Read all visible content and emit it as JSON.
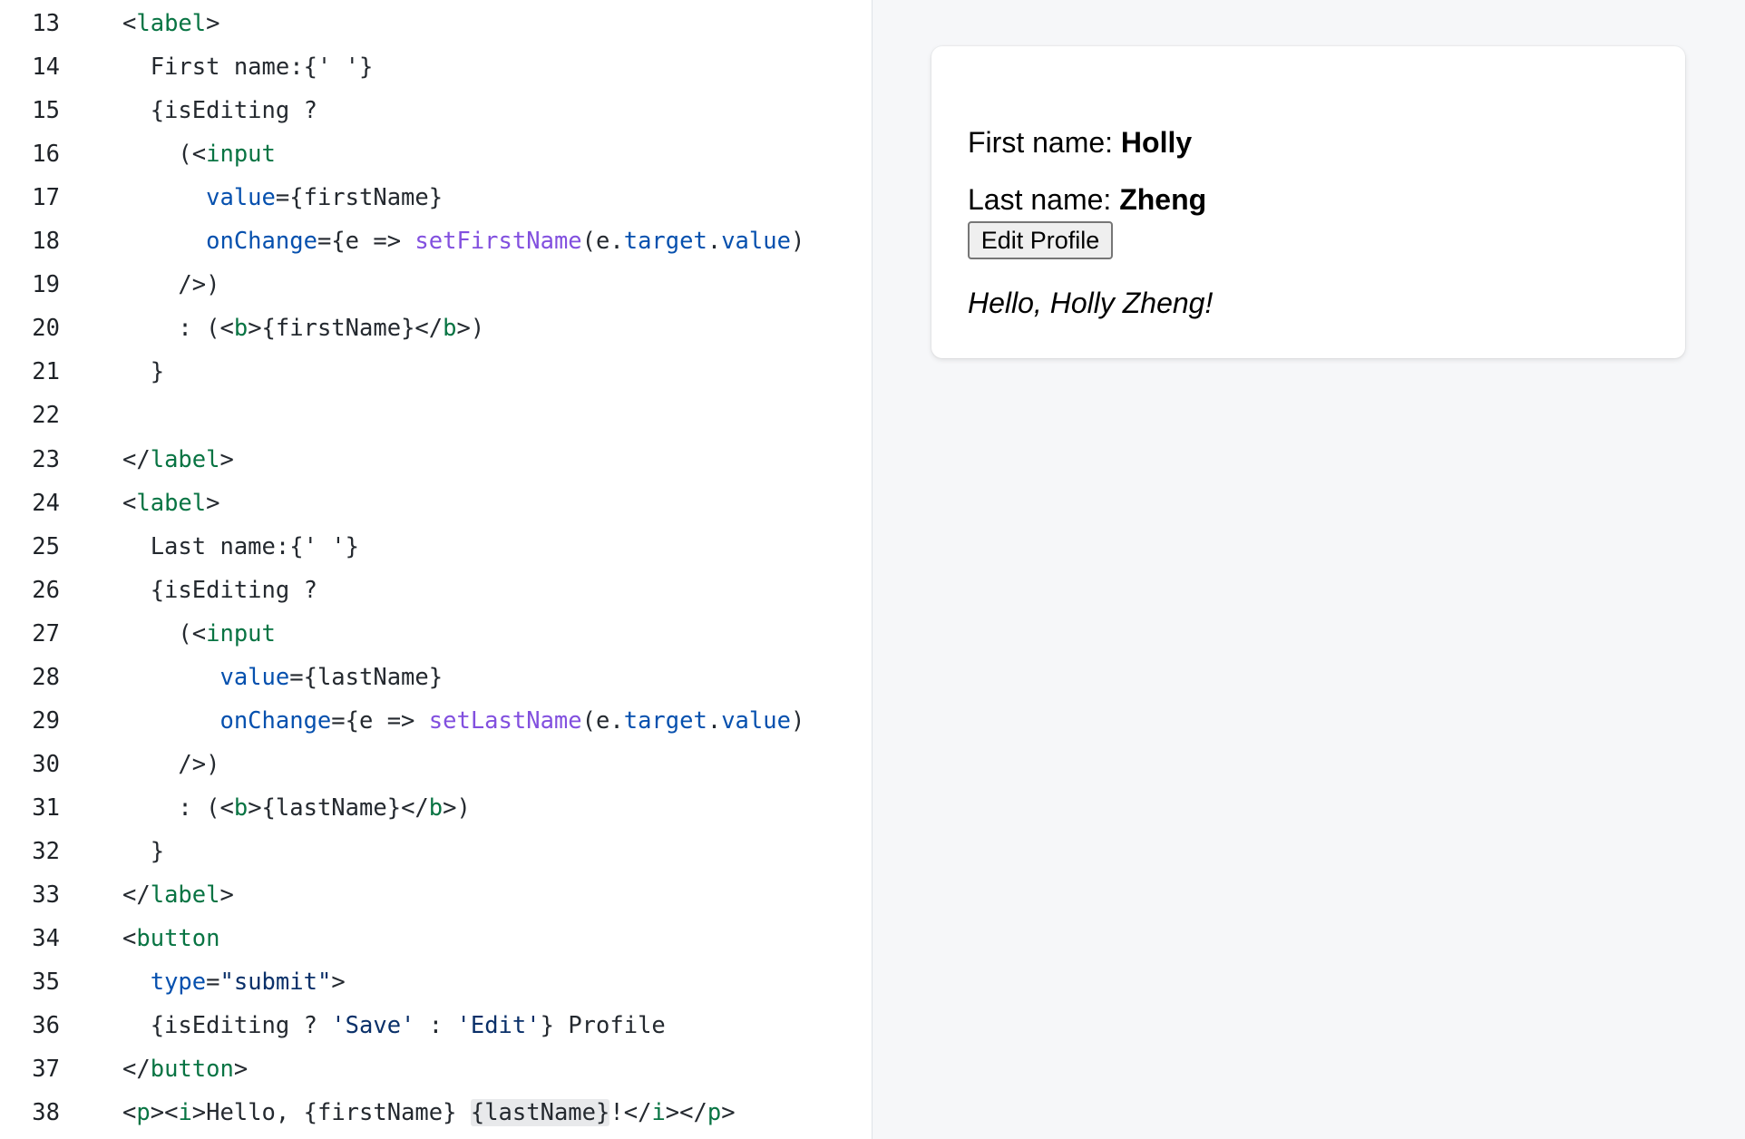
{
  "editor": {
    "lines": [
      {
        "num": "13",
        "parts": [
          "",
          "<",
          "label",
          ">"
        ]
      },
      {
        "num": "14",
        "text": "  First name:{' '}"
      },
      {
        "num": "15",
        "text": "  {isEditing ?"
      },
      {
        "num": "16",
        "parts": [
          "    (",
          "<",
          "input",
          ""
        ]
      },
      {
        "num": "17",
        "parts": [
          "      ",
          "value",
          "={firstName}"
        ]
      },
      {
        "num": "18",
        "parts": [
          "      ",
          "onChange",
          "={e => ",
          "setFirstName",
          "(e.",
          "target",
          ".",
          "value",
          ")"
        ]
      },
      {
        "num": "19",
        "text": "    />)"
      },
      {
        "num": "20",
        "parts": [
          "    : (<",
          "b",
          ">{firstName}</",
          "b",
          ">)"
        ]
      },
      {
        "num": "21",
        "text": "  }"
      },
      {
        "num": "22",
        "text": ""
      },
      {
        "num": "23",
        "parts": [
          "</",
          "label",
          ">"
        ]
      },
      {
        "num": "24",
        "parts": [
          "",
          "<",
          "label",
          ">"
        ]
      },
      {
        "num": "25",
        "text": "  Last name:{' '}"
      },
      {
        "num": "26",
        "text": "  {isEditing ?"
      },
      {
        "num": "27",
        "parts": [
          "    (",
          "<",
          "input",
          ""
        ]
      },
      {
        "num": "28",
        "parts": [
          "       ",
          "value",
          "={lastName}"
        ]
      },
      {
        "num": "29",
        "parts": [
          "       ",
          "onChange",
          "={e => ",
          "setLastName",
          "(e.",
          "target",
          ".",
          "value",
          ")"
        ]
      },
      {
        "num": "30",
        "text": "    />)"
      },
      {
        "num": "31",
        "parts": [
          "    : (<",
          "b",
          ">{lastName}</",
          "b",
          ">)"
        ]
      },
      {
        "num": "32",
        "text": "  }"
      },
      {
        "num": "33",
        "parts": [
          "</",
          "label",
          ">"
        ]
      },
      {
        "num": "34",
        "parts": [
          "<",
          "button"
        ]
      },
      {
        "num": "35",
        "parts": [
          "  ",
          "type",
          "=",
          "\"submit\"",
          ">"
        ]
      },
      {
        "num": "36",
        "parts": [
          "  {isEditing ? ",
          "'Save'",
          " : ",
          "'Edit'",
          "} Profile"
        ]
      },
      {
        "num": "37",
        "parts": [
          "</",
          "button",
          ">"
        ]
      },
      {
        "num": "38",
        "parts": [
          "<",
          "p",
          "><",
          "i",
          ">Hello, {firstName} ",
          "{lastName}",
          "!</",
          "i",
          "></",
          "p",
          ">"
        ]
      }
    ]
  },
  "preview": {
    "first_label": "First name: ",
    "first_value": "Holly",
    "last_label": "Last name: ",
    "last_value": "Zheng",
    "button_label": "Edit Profile",
    "greeting": "Hello, Holly Zheng!"
  }
}
